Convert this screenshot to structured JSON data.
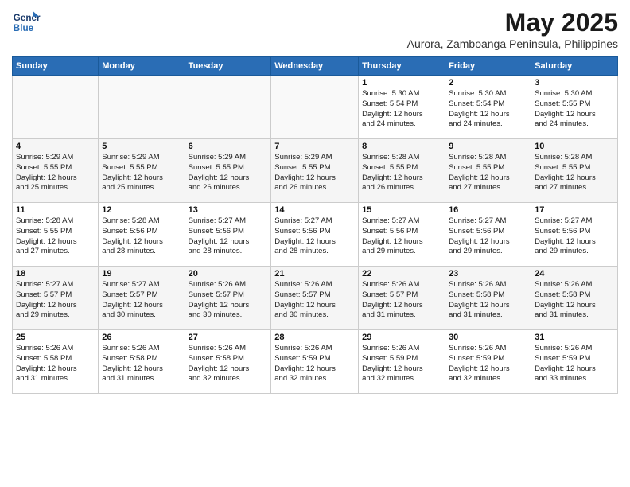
{
  "logo": {
    "line1": "General",
    "line2": "Blue"
  },
  "title": "May 2025",
  "subtitle": "Aurora, Zamboanga Peninsula, Philippines",
  "days_of_week": [
    "Sunday",
    "Monday",
    "Tuesday",
    "Wednesday",
    "Thursday",
    "Friday",
    "Saturday"
  ],
  "weeks": [
    [
      {
        "day": "",
        "info": ""
      },
      {
        "day": "",
        "info": ""
      },
      {
        "day": "",
        "info": ""
      },
      {
        "day": "",
        "info": ""
      },
      {
        "day": "1",
        "info": "Sunrise: 5:30 AM\nSunset: 5:54 PM\nDaylight: 12 hours\nand 24 minutes."
      },
      {
        "day": "2",
        "info": "Sunrise: 5:30 AM\nSunset: 5:54 PM\nDaylight: 12 hours\nand 24 minutes."
      },
      {
        "day": "3",
        "info": "Sunrise: 5:30 AM\nSunset: 5:55 PM\nDaylight: 12 hours\nand 24 minutes."
      }
    ],
    [
      {
        "day": "4",
        "info": "Sunrise: 5:29 AM\nSunset: 5:55 PM\nDaylight: 12 hours\nand 25 minutes."
      },
      {
        "day": "5",
        "info": "Sunrise: 5:29 AM\nSunset: 5:55 PM\nDaylight: 12 hours\nand 25 minutes."
      },
      {
        "day": "6",
        "info": "Sunrise: 5:29 AM\nSunset: 5:55 PM\nDaylight: 12 hours\nand 26 minutes."
      },
      {
        "day": "7",
        "info": "Sunrise: 5:29 AM\nSunset: 5:55 PM\nDaylight: 12 hours\nand 26 minutes."
      },
      {
        "day": "8",
        "info": "Sunrise: 5:28 AM\nSunset: 5:55 PM\nDaylight: 12 hours\nand 26 minutes."
      },
      {
        "day": "9",
        "info": "Sunrise: 5:28 AM\nSunset: 5:55 PM\nDaylight: 12 hours\nand 27 minutes."
      },
      {
        "day": "10",
        "info": "Sunrise: 5:28 AM\nSunset: 5:55 PM\nDaylight: 12 hours\nand 27 minutes."
      }
    ],
    [
      {
        "day": "11",
        "info": "Sunrise: 5:28 AM\nSunset: 5:55 PM\nDaylight: 12 hours\nand 27 minutes."
      },
      {
        "day": "12",
        "info": "Sunrise: 5:28 AM\nSunset: 5:56 PM\nDaylight: 12 hours\nand 28 minutes."
      },
      {
        "day": "13",
        "info": "Sunrise: 5:27 AM\nSunset: 5:56 PM\nDaylight: 12 hours\nand 28 minutes."
      },
      {
        "day": "14",
        "info": "Sunrise: 5:27 AM\nSunset: 5:56 PM\nDaylight: 12 hours\nand 28 minutes."
      },
      {
        "day": "15",
        "info": "Sunrise: 5:27 AM\nSunset: 5:56 PM\nDaylight: 12 hours\nand 29 minutes."
      },
      {
        "day": "16",
        "info": "Sunrise: 5:27 AM\nSunset: 5:56 PM\nDaylight: 12 hours\nand 29 minutes."
      },
      {
        "day": "17",
        "info": "Sunrise: 5:27 AM\nSunset: 5:56 PM\nDaylight: 12 hours\nand 29 minutes."
      }
    ],
    [
      {
        "day": "18",
        "info": "Sunrise: 5:27 AM\nSunset: 5:57 PM\nDaylight: 12 hours\nand 29 minutes."
      },
      {
        "day": "19",
        "info": "Sunrise: 5:27 AM\nSunset: 5:57 PM\nDaylight: 12 hours\nand 30 minutes."
      },
      {
        "day": "20",
        "info": "Sunrise: 5:26 AM\nSunset: 5:57 PM\nDaylight: 12 hours\nand 30 minutes."
      },
      {
        "day": "21",
        "info": "Sunrise: 5:26 AM\nSunset: 5:57 PM\nDaylight: 12 hours\nand 30 minutes."
      },
      {
        "day": "22",
        "info": "Sunrise: 5:26 AM\nSunset: 5:57 PM\nDaylight: 12 hours\nand 31 minutes."
      },
      {
        "day": "23",
        "info": "Sunrise: 5:26 AM\nSunset: 5:58 PM\nDaylight: 12 hours\nand 31 minutes."
      },
      {
        "day": "24",
        "info": "Sunrise: 5:26 AM\nSunset: 5:58 PM\nDaylight: 12 hours\nand 31 minutes."
      }
    ],
    [
      {
        "day": "25",
        "info": "Sunrise: 5:26 AM\nSunset: 5:58 PM\nDaylight: 12 hours\nand 31 minutes."
      },
      {
        "day": "26",
        "info": "Sunrise: 5:26 AM\nSunset: 5:58 PM\nDaylight: 12 hours\nand 31 minutes."
      },
      {
        "day": "27",
        "info": "Sunrise: 5:26 AM\nSunset: 5:58 PM\nDaylight: 12 hours\nand 32 minutes."
      },
      {
        "day": "28",
        "info": "Sunrise: 5:26 AM\nSunset: 5:59 PM\nDaylight: 12 hours\nand 32 minutes."
      },
      {
        "day": "29",
        "info": "Sunrise: 5:26 AM\nSunset: 5:59 PM\nDaylight: 12 hours\nand 32 minutes."
      },
      {
        "day": "30",
        "info": "Sunrise: 5:26 AM\nSunset: 5:59 PM\nDaylight: 12 hours\nand 32 minutes."
      },
      {
        "day": "31",
        "info": "Sunrise: 5:26 AM\nSunset: 5:59 PM\nDaylight: 12 hours\nand 33 minutes."
      }
    ]
  ]
}
